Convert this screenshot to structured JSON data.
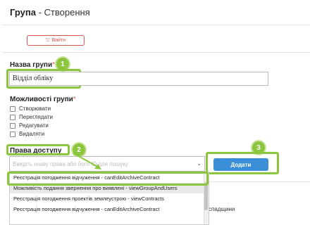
{
  "header": {
    "title_bold": "Група",
    "title_rest": " - Створення"
  },
  "exit_button": {
    "label": "Вийти"
  },
  "name_field": {
    "label": "Назва групи",
    "required_mark": "*",
    "value": "Відділ обліку"
  },
  "capabilities": {
    "label": "Можливості групи",
    "required_mark": "*",
    "items": [
      "Створювати",
      "Переглядати",
      "Редагувати",
      "Видаляти"
    ]
  },
  "access": {
    "label": "Права доступу",
    "placeholder": "Введіть назву права або його ID для пошуку",
    "add_label": "Додати",
    "options": [
      "Реєстрація погодження відчуження - canEditArchiveContract",
      "Можливість подання звернення про виявлені - viewGroupAndUsers",
      "Реєстрація погодження проектів землеустрою - viewContracts",
      "Реєстрація погодження відчуження - canEditArchiveContract"
    ],
    "highlighted_index": 1
  },
  "behind_text": "спадщини",
  "badges": [
    "1",
    "2",
    "3"
  ],
  "colors": {
    "highlight_green": "#8cc63e",
    "primary_blue": "#3a8fd8",
    "danger_red": "#d9534f"
  }
}
